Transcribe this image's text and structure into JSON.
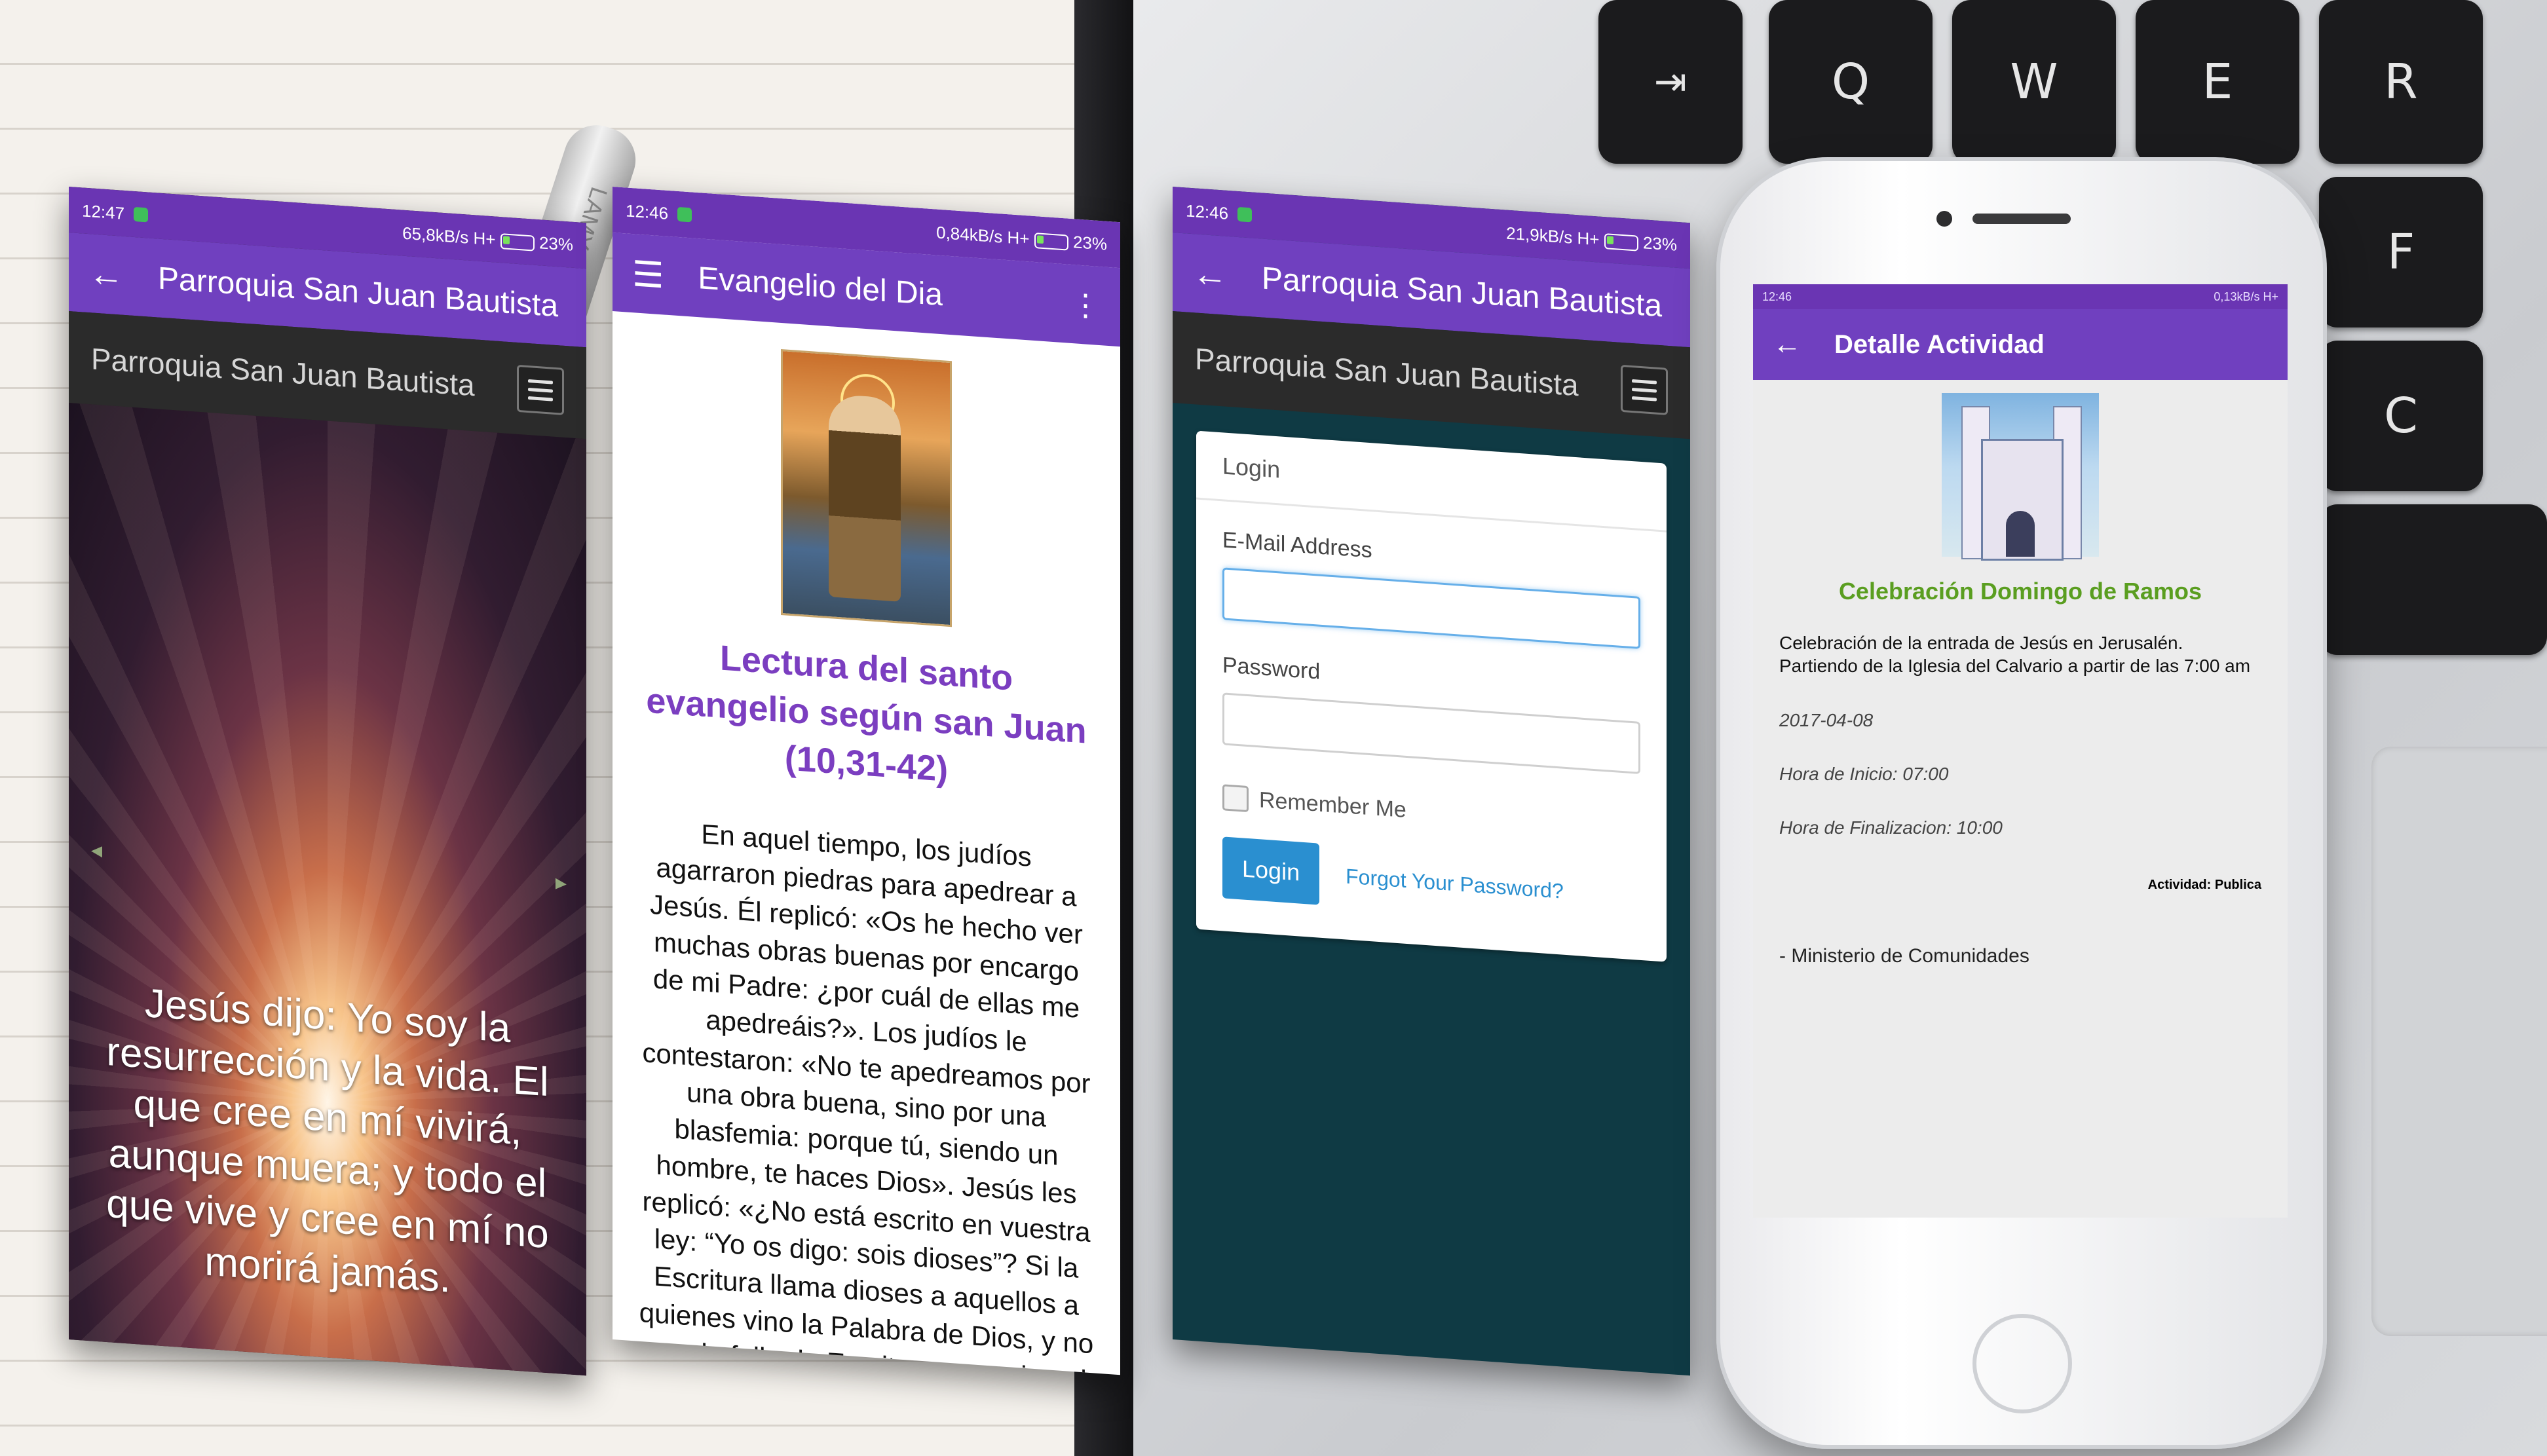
{
  "panel1": {
    "status": {
      "time": "12:47",
      "speed": "65,8kB/s",
      "network": "H+",
      "battery": "23%"
    },
    "appbar": {
      "title": "Parroquia San Juan Bautista"
    },
    "subbar": {
      "title": "Parroquia San Juan Bautista"
    },
    "quote": "Jesús dijo: Yo soy la resurrección y la vida. El que cree en mí vivirá, aunque muera; y todo el que vive y cree en mí no morirá jamás."
  },
  "panel2": {
    "status": {
      "time": "12:46",
      "speed": "0,84kB/s",
      "network": "H+",
      "battery": "23%"
    },
    "appbar": {
      "title": "Evangelio del Dia"
    },
    "reading_title": "Lectura del santo evangelio según san Juan (10,31-42)",
    "reading_text": "En aquel tiempo, los judíos agarraron piedras para apedrear a Jesús. Él replicó: «Os he hecho ver muchas obras buenas por encargo de mi Padre: ¿por cuál de ellas me apedreáis?». Los judíos le contestaron: «No te apedreamos por una obra buena, sino por una blasfemia: porque tú, siendo un hombre, te haces Dios». Jesús les replicó: «¿No está escrito en vuestra ley: “Yo os digo: sois dioses”? Si la Escritura llama dioses a aquellos a quienes vino la Palabra de Dios, y no puede fallar la Escritura, ¿a quien el"
  },
  "panel3": {
    "status": {
      "time": "12:46",
      "speed": "21,9kB/s",
      "network": "H+",
      "battery": "23%"
    },
    "appbar": {
      "title": "Parroquia San Juan Bautista"
    },
    "subbar": {
      "title": "Parroquia San Juan Bautista"
    },
    "login": {
      "heading": "Login",
      "email_label": "E-Mail Address",
      "email_value": "",
      "password_label": "Password",
      "password_value": "",
      "remember_label": "Remember Me",
      "login_button": "Login",
      "forgot_link": "Forgot Your Password?"
    }
  },
  "phone": {
    "status": {
      "time": "12:46",
      "speed": "0,13kB/s",
      "network": "H+"
    },
    "appbar": {
      "title": "Detalle Actividad"
    },
    "activity": {
      "title": "Celebración Domingo de Ramos",
      "description": "Celebración de la entrada de Jesús en Jerusalén. Partiendo de la Iglesia del Calvario a partir de las 7:00 am",
      "date": "2017-04-08",
      "start": "Hora de Inicio: 07:00",
      "end": "Hora de Finalizacion: 10:00",
      "status": "Actividad: Publica",
      "ministry": "- Ministerio de Comunidades"
    }
  },
  "keyboard": {
    "keys": [
      "Q",
      "W",
      "E",
      "R",
      "F",
      "C"
    ]
  },
  "pen": {
    "brand": "LAMY"
  },
  "colors": {
    "purple_appbar": "#7040bf",
    "purple_status": "#6a35b3",
    "login_bg": "#0f3a44",
    "link_blue": "#2a8fd0",
    "activity_green": "#5a9e20"
  }
}
